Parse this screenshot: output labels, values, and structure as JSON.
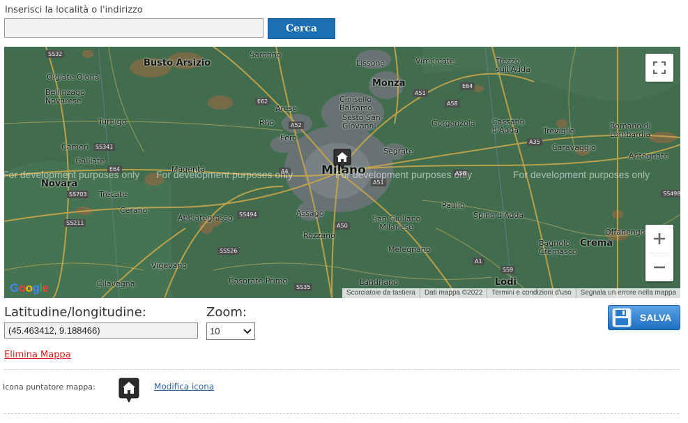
{
  "search": {
    "label": "Inserisci la località o l'indirizzo",
    "value": "",
    "button_label": "Cerca"
  },
  "map": {
    "places": {
      "saronno": "Saronno",
      "busto": "Busto Arsizio",
      "olgiate": "Olgiate Olona",
      "bellinzago": "Bellinzago\nNovarese",
      "lissone": "Lissone",
      "vimercate": "Vimercate",
      "trezzo": "Trezzo\nsull'Adda",
      "monza": "Monza",
      "cinisello": "Cinisello\nBalsamo",
      "sesto": "Sesto San\nGiovanni",
      "arese": "Arese",
      "rho": "Rho",
      "pero": "Pero",
      "turbigo": "Turbigo",
      "cameri": "Cameri",
      "galliate": "Galliate",
      "magenta": "Magenta",
      "milano": "Milano",
      "segrate": "Segrate",
      "gorgonzola": "Gorgonzola",
      "cassano": "Cassano\nd'Adda",
      "treviglio": "Treviglio",
      "caravaggio": "Caravaggio",
      "romano": "Romano di\nLombardia",
      "antegnate": "Antegnate",
      "novara": "Novara",
      "trecate": "Trecate",
      "cerano": "Cerano",
      "abbiategrasso": "Abbiategrasso",
      "assago": "Assago",
      "rozzano": "Rozzano",
      "sangiuliano": "San Giuliano\nMilanese",
      "paullo": "Paullo",
      "spino": "Spino d'Adda",
      "offanengo": "Offanengo",
      "crema": "Crema",
      "bagnolo": "Bagnolo\nCremasco",
      "melegnano": "Melegnano",
      "vigevano": "Vigevano",
      "cilavegna": "Cilavegna",
      "casorate": "Casorate Primo",
      "landriano": "Landriano",
      "lodi": "Lodi"
    },
    "roads": {
      "ss32": "SS32",
      "e62": "E62",
      "a52": "A52",
      "ss341": "SS341",
      "e64a": "E64",
      "ss703": "SS703",
      "ss211": "SS211",
      "a4": "A4",
      "ss494": "SS494",
      "ss526": "SS526",
      "ss35": "SS35",
      "a50": "A50",
      "a51a": "A51",
      "a51b": "A51",
      "a58a": "A58",
      "a58b": "A58",
      "e64b": "E64",
      "a35": "A35",
      "ss498": "SS498",
      "a1": "A1",
      "ss9": "SS9"
    },
    "watermark": "For development purposes only",
    "google_logo": "Google",
    "attribution": {
      "shortcuts": "Scorciatoie da tastiera",
      "mapdata": "Dati mappa ©2022",
      "terms": "Termini e condizioni d'uso",
      "report": "Segnala un errore nella mappa"
    }
  },
  "coords": {
    "label": "Latitudine/longitudine:",
    "value": "(45.463412, 9.188466)"
  },
  "zoom": {
    "label": "Zoom:",
    "value": "10"
  },
  "save_label": "SALVA",
  "delete_label": "Elimina Mappa",
  "marker_icon": {
    "label": "Icona puntatore mappa:",
    "modify_label": "Modifica icona",
    "icon": "home-marker-icon"
  }
}
